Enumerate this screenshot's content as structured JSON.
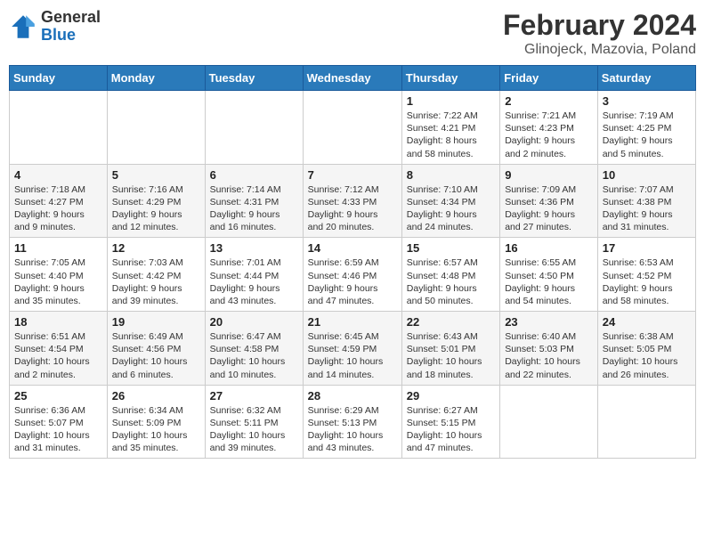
{
  "header": {
    "logo_general": "General",
    "logo_blue": "Blue",
    "title": "February 2024",
    "location": "Glinojeck, Mazovia, Poland"
  },
  "days_of_week": [
    "Sunday",
    "Monday",
    "Tuesday",
    "Wednesday",
    "Thursday",
    "Friday",
    "Saturday"
  ],
  "weeks": [
    [
      {
        "day": "",
        "info": ""
      },
      {
        "day": "",
        "info": ""
      },
      {
        "day": "",
        "info": ""
      },
      {
        "day": "",
        "info": ""
      },
      {
        "day": "1",
        "info": "Sunrise: 7:22 AM\nSunset: 4:21 PM\nDaylight: 8 hours\nand 58 minutes."
      },
      {
        "day": "2",
        "info": "Sunrise: 7:21 AM\nSunset: 4:23 PM\nDaylight: 9 hours\nand 2 minutes."
      },
      {
        "day": "3",
        "info": "Sunrise: 7:19 AM\nSunset: 4:25 PM\nDaylight: 9 hours\nand 5 minutes."
      }
    ],
    [
      {
        "day": "4",
        "info": "Sunrise: 7:18 AM\nSunset: 4:27 PM\nDaylight: 9 hours\nand 9 minutes."
      },
      {
        "day": "5",
        "info": "Sunrise: 7:16 AM\nSunset: 4:29 PM\nDaylight: 9 hours\nand 12 minutes."
      },
      {
        "day": "6",
        "info": "Sunrise: 7:14 AM\nSunset: 4:31 PM\nDaylight: 9 hours\nand 16 minutes."
      },
      {
        "day": "7",
        "info": "Sunrise: 7:12 AM\nSunset: 4:33 PM\nDaylight: 9 hours\nand 20 minutes."
      },
      {
        "day": "8",
        "info": "Sunrise: 7:10 AM\nSunset: 4:34 PM\nDaylight: 9 hours\nand 24 minutes."
      },
      {
        "day": "9",
        "info": "Sunrise: 7:09 AM\nSunset: 4:36 PM\nDaylight: 9 hours\nand 27 minutes."
      },
      {
        "day": "10",
        "info": "Sunrise: 7:07 AM\nSunset: 4:38 PM\nDaylight: 9 hours\nand 31 minutes."
      }
    ],
    [
      {
        "day": "11",
        "info": "Sunrise: 7:05 AM\nSunset: 4:40 PM\nDaylight: 9 hours\nand 35 minutes."
      },
      {
        "day": "12",
        "info": "Sunrise: 7:03 AM\nSunset: 4:42 PM\nDaylight: 9 hours\nand 39 minutes."
      },
      {
        "day": "13",
        "info": "Sunrise: 7:01 AM\nSunset: 4:44 PM\nDaylight: 9 hours\nand 43 minutes."
      },
      {
        "day": "14",
        "info": "Sunrise: 6:59 AM\nSunset: 4:46 PM\nDaylight: 9 hours\nand 47 minutes."
      },
      {
        "day": "15",
        "info": "Sunrise: 6:57 AM\nSunset: 4:48 PM\nDaylight: 9 hours\nand 50 minutes."
      },
      {
        "day": "16",
        "info": "Sunrise: 6:55 AM\nSunset: 4:50 PM\nDaylight: 9 hours\nand 54 minutes."
      },
      {
        "day": "17",
        "info": "Sunrise: 6:53 AM\nSunset: 4:52 PM\nDaylight: 9 hours\nand 58 minutes."
      }
    ],
    [
      {
        "day": "18",
        "info": "Sunrise: 6:51 AM\nSunset: 4:54 PM\nDaylight: 10 hours\nand 2 minutes."
      },
      {
        "day": "19",
        "info": "Sunrise: 6:49 AM\nSunset: 4:56 PM\nDaylight: 10 hours\nand 6 minutes."
      },
      {
        "day": "20",
        "info": "Sunrise: 6:47 AM\nSunset: 4:58 PM\nDaylight: 10 hours\nand 10 minutes."
      },
      {
        "day": "21",
        "info": "Sunrise: 6:45 AM\nSunset: 4:59 PM\nDaylight: 10 hours\nand 14 minutes."
      },
      {
        "day": "22",
        "info": "Sunrise: 6:43 AM\nSunset: 5:01 PM\nDaylight: 10 hours\nand 18 minutes."
      },
      {
        "day": "23",
        "info": "Sunrise: 6:40 AM\nSunset: 5:03 PM\nDaylight: 10 hours\nand 22 minutes."
      },
      {
        "day": "24",
        "info": "Sunrise: 6:38 AM\nSunset: 5:05 PM\nDaylight: 10 hours\nand 26 minutes."
      }
    ],
    [
      {
        "day": "25",
        "info": "Sunrise: 6:36 AM\nSunset: 5:07 PM\nDaylight: 10 hours\nand 31 minutes."
      },
      {
        "day": "26",
        "info": "Sunrise: 6:34 AM\nSunset: 5:09 PM\nDaylight: 10 hours\nand 35 minutes."
      },
      {
        "day": "27",
        "info": "Sunrise: 6:32 AM\nSunset: 5:11 PM\nDaylight: 10 hours\nand 39 minutes."
      },
      {
        "day": "28",
        "info": "Sunrise: 6:29 AM\nSunset: 5:13 PM\nDaylight: 10 hours\nand 43 minutes."
      },
      {
        "day": "29",
        "info": "Sunrise: 6:27 AM\nSunset: 5:15 PM\nDaylight: 10 hours\nand 47 minutes."
      },
      {
        "day": "",
        "info": ""
      },
      {
        "day": "",
        "info": ""
      }
    ]
  ]
}
